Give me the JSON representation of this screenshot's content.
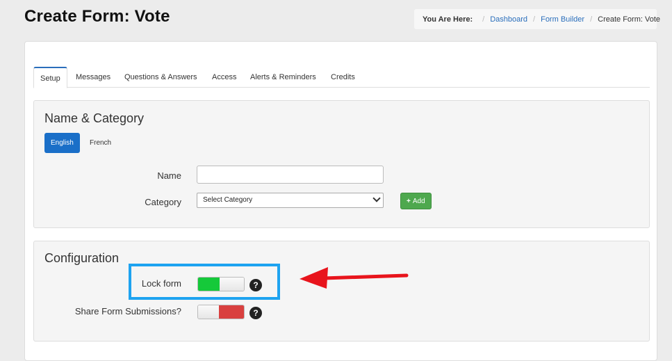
{
  "page": {
    "title": "Create Form: Vote"
  },
  "breadcrumb": {
    "label": "You Are Here:",
    "items": [
      "Dashboard",
      "Form Builder"
    ],
    "current": "Create Form: Vote"
  },
  "tabs": [
    "Setup",
    "Messages",
    "Questions & Answers",
    "Access",
    "Alerts & Reminders",
    "Credits"
  ],
  "active_tab": "Setup",
  "name_category": {
    "title": "Name & Category",
    "languages": [
      "English",
      "French"
    ],
    "active_language": "English",
    "name_label": "Name",
    "name_value": "",
    "category_label": "Category",
    "category_selected": "Select Category",
    "add_label": "Add"
  },
  "configuration": {
    "title": "Configuration",
    "lock_form_label": "Lock form",
    "lock_form_on": true,
    "share_label": "Share Form Submissions?",
    "share_on": false,
    "help_glyph": "?"
  },
  "colors": {
    "primary": "#1a6fc8",
    "toggle_on": "#15c93a",
    "toggle_off": "#d9403f",
    "highlight": "#1ea3f0",
    "arrow": "#e8141c",
    "add": "#4ea84e"
  },
  "icons": {
    "add": "plus-icon",
    "help": "question-circle-icon",
    "select": "chevron-down-icon",
    "annotation": "arrow-left-icon"
  }
}
